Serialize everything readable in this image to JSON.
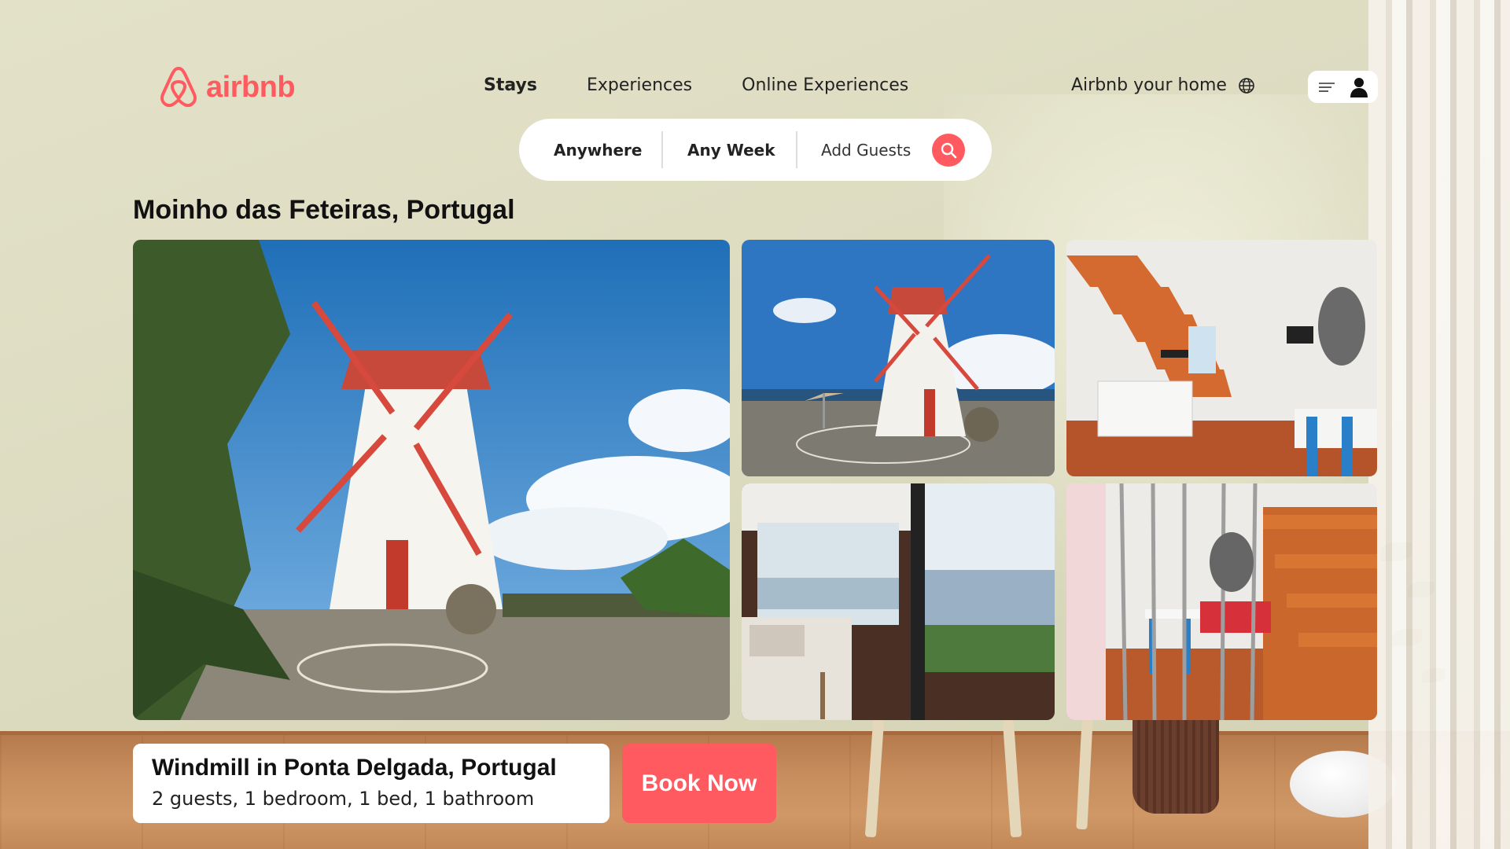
{
  "brand": {
    "name": "airbnb",
    "color": "#ff5a5f"
  },
  "nav": {
    "items": [
      {
        "label": "Stays",
        "active": true
      },
      {
        "label": "Experiences",
        "active": false
      },
      {
        "label": "Online Experiences",
        "active": false
      }
    ],
    "host_label": "Airbnb your home",
    "host_icon": "globe-icon",
    "menu_icons": [
      "hamburger-icon",
      "user-icon"
    ]
  },
  "search": {
    "where": "Anywhere",
    "when": "Any Week",
    "guests": "Add Guests",
    "button_icon": "search-icon"
  },
  "listing": {
    "location_title": "Moinho das Feteiras, Portugal",
    "photos": [
      {
        "name": "windmill-main-photo",
        "subject": "windmill"
      },
      {
        "name": "windmill-patio-photo",
        "subject": "windmill"
      },
      {
        "name": "kitchen-stairs-photo",
        "subject": "kitchen"
      },
      {
        "name": "bedroom-window-photo",
        "subject": "bedroom"
      },
      {
        "name": "living-room-photo",
        "subject": "living room"
      }
    ],
    "card_title": "Windmill in Ponta Delgada, Portugal",
    "card_details": "2 guests, 1 bedroom, 1 bed, 1 bathroom",
    "book_label": "Book Now"
  }
}
